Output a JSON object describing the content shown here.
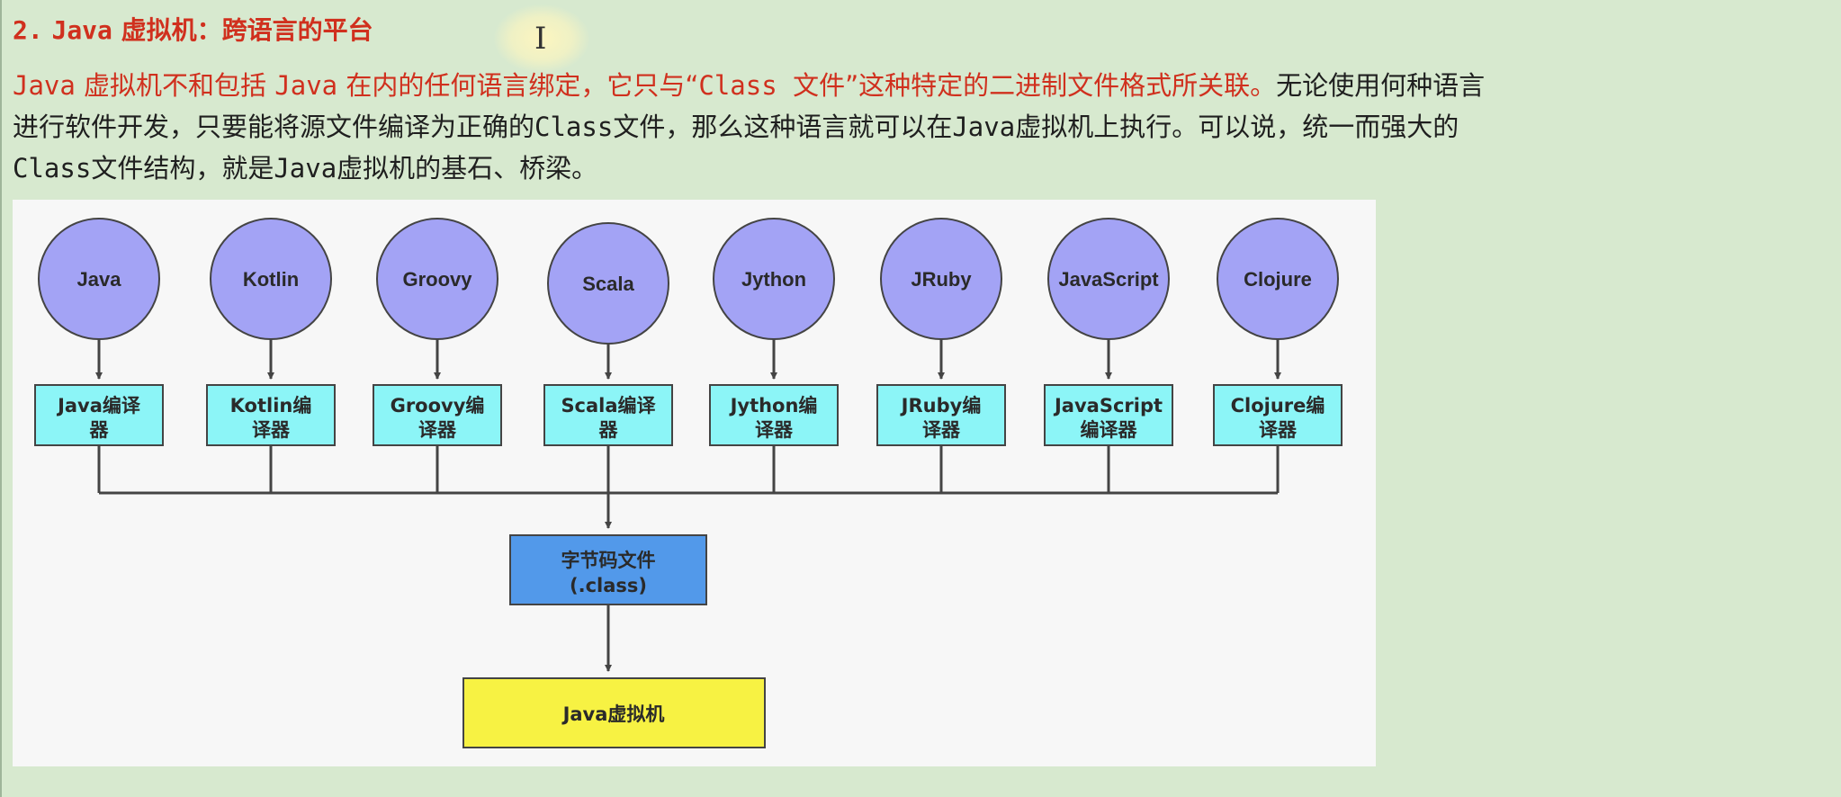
{
  "heading": {
    "number": "2.",
    "title_java": "Java",
    "title_rest": "虚拟机：跨语言的平台"
  },
  "paragraph": {
    "line1": [
      {
        "text": "Java",
        "style": "red-mono"
      },
      {
        "text": " 虚拟机不和包括 ",
        "style": "red"
      },
      {
        "text": "Java",
        "style": "red-mono"
      },
      {
        "text": " 在内的任何语言绑定，它只与“",
        "style": "red"
      },
      {
        "text": "Class 文件",
        "style": "red-mono"
      },
      {
        "text": "”这种特定的二进制文件格式所关联。",
        "style": "red"
      },
      {
        "text": "无论使用何种语言",
        "style": "plain"
      }
    ],
    "line2": [
      {
        "text": "进行软件开发，只要能将源文件编译为正确的",
        "style": "plain"
      },
      {
        "text": "Class",
        "style": "mono"
      },
      {
        "text": "文件，那么这种语言就可以在",
        "style": "plain"
      },
      {
        "text": "Java",
        "style": "mono"
      },
      {
        "text": "虚拟机上执行。可以说，统一而强大的",
        "style": "plain"
      }
    ],
    "line3": [
      {
        "text": "Class",
        "style": "mono"
      },
      {
        "text": "文件结构，就是",
        "style": "plain"
      },
      {
        "text": "Java",
        "style": "mono"
      },
      {
        "text": "虚拟机的基石、桥梁。",
        "style": "plain"
      }
    ]
  },
  "diagram": {
    "languages": [
      {
        "name": "Java",
        "compiler": [
          "Java编译",
          "器"
        ]
      },
      {
        "name": "Kotlin",
        "compiler": [
          "Kotlin编",
          "译器"
        ]
      },
      {
        "name": "Groovy",
        "compiler": [
          "Groovy编",
          "译器"
        ]
      },
      {
        "name": "Scala",
        "compiler": [
          "Scala编译",
          "器"
        ]
      },
      {
        "name": "Jython",
        "compiler": [
          "Jython编",
          "译器"
        ]
      },
      {
        "name": "JRuby",
        "compiler": [
          "JRuby编",
          "译器"
        ]
      },
      {
        "name": "JavaScript",
        "compiler": [
          "JavaScript",
          "编译器"
        ]
      },
      {
        "name": "Clojure",
        "compiler": [
          "Clojure编",
          "译器"
        ]
      }
    ],
    "bytecode": [
      "字节码文件",
      "(.class)"
    ],
    "jvm": "Java虚拟机",
    "colors": {
      "circle_fill": "#a3a3f5",
      "compiler_fill": "#8cf5f7",
      "bytecode_fill": "#5299ea",
      "jvm_fill": "#f7f243",
      "stroke": "#444444"
    }
  }
}
